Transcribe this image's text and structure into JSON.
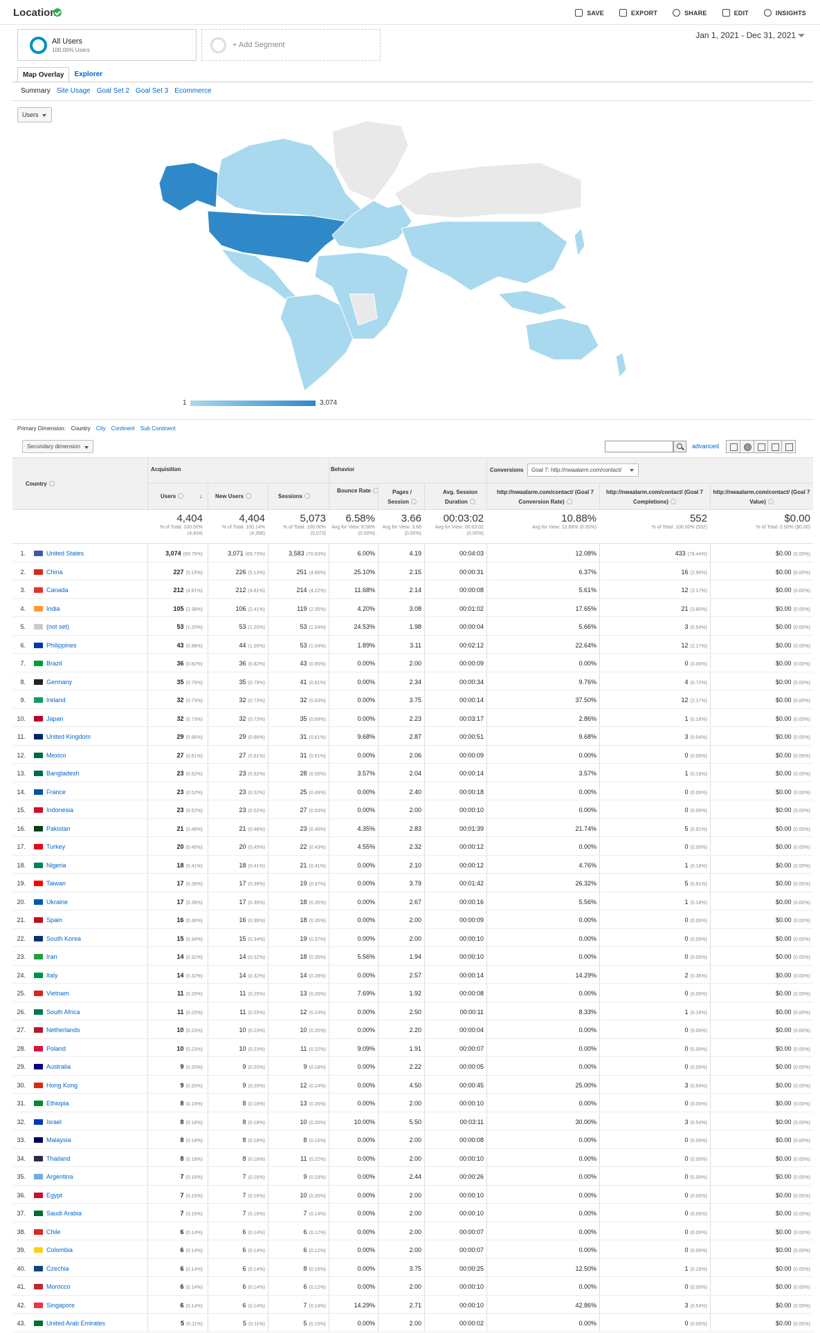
{
  "header": {
    "title": "Location",
    "actions": [
      {
        "label": "SAVE",
        "icon": "save-icon"
      },
      {
        "label": "EXPORT",
        "icon": "export-icon"
      },
      {
        "label": "SHARE",
        "icon": "share-icon"
      },
      {
        "label": "EDIT",
        "icon": "pencil-icon"
      },
      {
        "label": "INSIGHTS",
        "icon": "insights-icon"
      }
    ]
  },
  "segments": {
    "all_users": "All Users",
    "all_users_sub": "100.00% Users",
    "add_segment": "+ Add Segment"
  },
  "date_range": "Jan 1, 2021 - Dec 31, 2021",
  "view_tabs": [
    "Map Overlay",
    "Explorer"
  ],
  "sub_tabs": [
    "Summary",
    "Site Usage",
    "Goal Set 2",
    "Goal Set 3",
    "Ecommerce"
  ],
  "metric_select": "Users",
  "map": {
    "legend_min": "1",
    "legend_max": "3,074",
    "colors": {
      "low": "#a8d9ef",
      "high": "#2f88c7",
      "none": "#e9e9e9"
    }
  },
  "primary_dimension": {
    "label": "Primary Dimension:",
    "options": [
      "Country",
      "City",
      "Continent",
      "Sub Continent"
    ]
  },
  "secondary_dimension": "Secondary dimension",
  "advanced": "advanced",
  "table": {
    "groups": {
      "country": "Country",
      "acquisition": "Acquisition",
      "behavior": "Behavior",
      "conversions": "Conversions",
      "goal_select": "Goal 7: http://nwaalarm.com/contact/"
    },
    "columns": [
      "Users",
      "New Users",
      "Sessions",
      "Bounce Rate",
      "Pages / Session",
      "Avg. Session Duration",
      "http://nwaalarm.com/contact/ (Goal 7 Conversion Rate)",
      "http://nwaalarm.com/contact/ (Goal 7 Completions)",
      "http://nwaalarm.com/contact/ (Goal 7 Value)"
    ],
    "totals": [
      {
        "value": "4,404",
        "sub": "% of Total: 100.00% (4,404)"
      },
      {
        "value": "4,404",
        "sub": "% of Total: 100.14% (4,398)"
      },
      {
        "value": "5,073",
        "sub": "% of Total: 100.00% (5,073)"
      },
      {
        "value": "6.58%",
        "sub": "Avg for View: 6.58% (0.00%)"
      },
      {
        "value": "3.66",
        "sub": "Avg for View: 3.66 (0.00%)"
      },
      {
        "value": "00:03:02",
        "sub": "Avg for View: 00:03:02 (0.00%)"
      },
      {
        "value": "10.88%",
        "sub": "Avg for View: 10.88% (0.00%)"
      },
      {
        "value": "552",
        "sub": "% of Total: 100.00% (552)"
      },
      {
        "value": "$0.00",
        "sub": "% of Total: 0.00% ($0.00)"
      }
    ],
    "rows": [
      [
        "1.",
        "United States",
        "3,074",
        "(69.75%)",
        "3,071",
        "(69.73%)",
        "3,583",
        "(70.63%)",
        "6.00%",
        "4.19",
        "00:04:03",
        "12.08%",
        "433",
        "(78.44%)",
        "$0.00",
        "(0.00%)"
      ],
      [
        "2.",
        "China",
        "227",
        "(5.15%)",
        "226",
        "(5.13%)",
        "251",
        "(4.95%)",
        "25.10%",
        "2.15",
        "00:00:31",
        "6.37%",
        "16",
        "(2.90%)",
        "$0.00",
        "(0.00%)"
      ],
      [
        "3.",
        "Canada",
        "212",
        "(4.81%)",
        "212",
        "(4.81%)",
        "214",
        "(4.22%)",
        "11.68%",
        "2.14",
        "00:00:08",
        "5.61%",
        "12",
        "(2.17%)",
        "$0.00",
        "(0.00%)"
      ],
      [
        "4.",
        "India",
        "105",
        "(2.38%)",
        "106",
        "(2.41%)",
        "119",
        "(2.35%)",
        "4.20%",
        "3.08",
        "00:01:02",
        "17.65%",
        "21",
        "(3.80%)",
        "$0.00",
        "(0.00%)"
      ],
      [
        "5.",
        "(not set)",
        "53",
        "(1.20%)",
        "53",
        "(1.20%)",
        "53",
        "(1.04%)",
        "24.53%",
        "1.98",
        "00:00:04",
        "5.66%",
        "3",
        "(0.54%)",
        "$0.00",
        "(0.00%)"
      ],
      [
        "6.",
        "Philippines",
        "43",
        "(0.98%)",
        "44",
        "(1.00%)",
        "53",
        "(1.04%)",
        "1.89%",
        "3.11",
        "00:02:12",
        "22.64%",
        "12",
        "(2.17%)",
        "$0.00",
        "(0.00%)"
      ],
      [
        "7.",
        "Brazil",
        "36",
        "(0.82%)",
        "36",
        "(0.82%)",
        "43",
        "(0.85%)",
        "0.00%",
        "2.00",
        "00:00:09",
        "0.00%",
        "0",
        "(0.00%)",
        "$0.00",
        "(0.00%)"
      ],
      [
        "8.",
        "Germany",
        "35",
        "(0.79%)",
        "35",
        "(0.79%)",
        "41",
        "(0.81%)",
        "0.00%",
        "2.34",
        "00:00:34",
        "9.76%",
        "4",
        "(0.72%)",
        "$0.00",
        "(0.00%)"
      ],
      [
        "9.",
        "Ireland",
        "32",
        "(0.73%)",
        "32",
        "(0.73%)",
        "32",
        "(0.63%)",
        "0.00%",
        "3.75",
        "00:00:14",
        "37.50%",
        "12",
        "(2.17%)",
        "$0.00",
        "(0.00%)"
      ],
      [
        "10.",
        "Japan",
        "32",
        "(0.73%)",
        "32",
        "(0.73%)",
        "35",
        "(0.69%)",
        "0.00%",
        "2.23",
        "00:03:17",
        "2.86%",
        "1",
        "(0.18%)",
        "$0.00",
        "(0.00%)"
      ],
      [
        "11.",
        "United Kingdom",
        "29",
        "(0.66%)",
        "29",
        "(0.66%)",
        "31",
        "(0.61%)",
        "9.68%",
        "2.87",
        "00:00:51",
        "9.68%",
        "3",
        "(0.54%)",
        "$0.00",
        "(0.00%)"
      ],
      [
        "12.",
        "Mexico",
        "27",
        "(0.61%)",
        "27",
        "(0.61%)",
        "31",
        "(0.61%)",
        "0.00%",
        "2.06",
        "00:00:09",
        "0.00%",
        "0",
        "(0.00%)",
        "$0.00",
        "(0.00%)"
      ],
      [
        "13.",
        "Bangladesh",
        "23",
        "(0.52%)",
        "23",
        "(0.52%)",
        "28",
        "(0.55%)",
        "3.57%",
        "2.04",
        "00:00:14",
        "3.57%",
        "1",
        "(0.18%)",
        "$0.00",
        "(0.00%)"
      ],
      [
        "14.",
        "France",
        "23",
        "(0.52%)",
        "23",
        "(0.52%)",
        "25",
        "(0.49%)",
        "0.00%",
        "2.40",
        "00:00:18",
        "0.00%",
        "0",
        "(0.00%)",
        "$0.00",
        "(0.00%)"
      ],
      [
        "15.",
        "Indonesia",
        "23",
        "(0.52%)",
        "23",
        "(0.52%)",
        "27",
        "(0.53%)",
        "0.00%",
        "2.00",
        "00:00:10",
        "0.00%",
        "0",
        "(0.00%)",
        "$0.00",
        "(0.00%)"
      ],
      [
        "16.",
        "Pakistan",
        "21",
        "(0.48%)",
        "21",
        "(0.48%)",
        "23",
        "(0.45%)",
        "4.35%",
        "2.83",
        "00:01:39",
        "21.74%",
        "5",
        "(0.91%)",
        "$0.00",
        "(0.00%)"
      ],
      [
        "17.",
        "Turkey",
        "20",
        "(0.45%)",
        "20",
        "(0.45%)",
        "22",
        "(0.43%)",
        "4.55%",
        "2.32",
        "00:00:12",
        "0.00%",
        "0",
        "(0.00%)",
        "$0.00",
        "(0.00%)"
      ],
      [
        "18.",
        "Nigeria",
        "18",
        "(0.41%)",
        "18",
        "(0.41%)",
        "21",
        "(0.41%)",
        "0.00%",
        "2.10",
        "00:00:12",
        "4.76%",
        "1",
        "(0.18%)",
        "$0.00",
        "(0.00%)"
      ],
      [
        "19.",
        "Taiwan",
        "17",
        "(0.39%)",
        "17",
        "(0.39%)",
        "19",
        "(0.37%)",
        "0.00%",
        "3.79",
        "00:01:42",
        "26.32%",
        "5",
        "(0.91%)",
        "$0.00",
        "(0.00%)"
      ],
      [
        "20.",
        "Ukraine",
        "17",
        "(0.39%)",
        "17",
        "(0.39%)",
        "18",
        "(0.35%)",
        "0.00%",
        "2.67",
        "00:00:16",
        "5.56%",
        "1",
        "(0.18%)",
        "$0.00",
        "(0.00%)"
      ],
      [
        "21.",
        "Spain",
        "16",
        "(0.36%)",
        "16",
        "(0.36%)",
        "18",
        "(0.35%)",
        "0.00%",
        "2.00",
        "00:00:09",
        "0.00%",
        "0",
        "(0.00%)",
        "$0.00",
        "(0.00%)"
      ],
      [
        "22.",
        "South Korea",
        "15",
        "(0.34%)",
        "15",
        "(0.34%)",
        "19",
        "(0.37%)",
        "0.00%",
        "2.00",
        "00:00:10",
        "0.00%",
        "0",
        "(0.00%)",
        "$0.00",
        "(0.00%)"
      ],
      [
        "23.",
        "Iran",
        "14",
        "(0.32%)",
        "14",
        "(0.32%)",
        "18",
        "(0.35%)",
        "5.56%",
        "1.94",
        "00:00:10",
        "0.00%",
        "0",
        "(0.00%)",
        "$0.00",
        "(0.00%)"
      ],
      [
        "24.",
        "Italy",
        "14",
        "(0.32%)",
        "14",
        "(0.32%)",
        "14",
        "(0.28%)",
        "0.00%",
        "2.57",
        "00:00:14",
        "14.29%",
        "2",
        "(0.36%)",
        "$0.00",
        "(0.00%)"
      ],
      [
        "25.",
        "Vietnam",
        "11",
        "(0.25%)",
        "11",
        "(0.25%)",
        "13",
        "(0.26%)",
        "7.69%",
        "1.92",
        "00:00:08",
        "0.00%",
        "0",
        "(0.00%)",
        "$0.00",
        "(0.00%)"
      ],
      [
        "26.",
        "South Africa",
        "11",
        "(0.25%)",
        "11",
        "(0.25%)",
        "12",
        "(0.24%)",
        "0.00%",
        "2.50",
        "00:00:11",
        "8.33%",
        "1",
        "(0.18%)",
        "$0.00",
        "(0.00%)"
      ],
      [
        "27.",
        "Netherlands",
        "10",
        "(0.23%)",
        "10",
        "(0.23%)",
        "10",
        "(0.20%)",
        "0.00%",
        "2.20",
        "00:00:04",
        "0.00%",
        "0",
        "(0.00%)",
        "$0.00",
        "(0.00%)"
      ],
      [
        "28.",
        "Poland",
        "10",
        "(0.23%)",
        "10",
        "(0.23%)",
        "11",
        "(0.22%)",
        "9.09%",
        "1.91",
        "00:00:07",
        "0.00%",
        "0",
        "(0.00%)",
        "$0.00",
        "(0.00%)"
      ],
      [
        "29.",
        "Australia",
        "9",
        "(0.20%)",
        "9",
        "(0.20%)",
        "9",
        "(0.18%)",
        "0.00%",
        "2.22",
        "00:00:05",
        "0.00%",
        "0",
        "(0.00%)",
        "$0.00",
        "(0.00%)"
      ],
      [
        "30.",
        "Hong Kong",
        "9",
        "(0.20%)",
        "9",
        "(0.20%)",
        "12",
        "(0.24%)",
        "0.00%",
        "4.50",
        "00:00:45",
        "25.00%",
        "3",
        "(0.54%)",
        "$0.00",
        "(0.00%)"
      ],
      [
        "31.",
        "Ethiopia",
        "8",
        "(0.18%)",
        "8",
        "(0.18%)",
        "13",
        "(0.26%)",
        "0.00%",
        "2.00",
        "00:00:10",
        "0.00%",
        "0",
        "(0.00%)",
        "$0.00",
        "(0.00%)"
      ],
      [
        "32.",
        "Israel",
        "8",
        "(0.18%)",
        "8",
        "(0.18%)",
        "10",
        "(0.20%)",
        "10.00%",
        "5.50",
        "00:03:11",
        "30.00%",
        "3",
        "(0.54%)",
        "$0.00",
        "(0.00%)"
      ],
      [
        "33.",
        "Malaysia",
        "8",
        "(0.18%)",
        "8",
        "(0.18%)",
        "8",
        "(0.16%)",
        "0.00%",
        "2.00",
        "00:00:08",
        "0.00%",
        "0",
        "(0.00%)",
        "$0.00",
        "(0.00%)"
      ],
      [
        "34.",
        "Thailand",
        "8",
        "(0.18%)",
        "8",
        "(0.18%)",
        "11",
        "(0.22%)",
        "0.00%",
        "2.00",
        "00:00:10",
        "0.00%",
        "0",
        "(0.00%)",
        "$0.00",
        "(0.00%)"
      ],
      [
        "35.",
        "Argentina",
        "7",
        "(0.16%)",
        "7",
        "(0.16%)",
        "9",
        "(0.18%)",
        "0.00%",
        "2.44",
        "00:00:26",
        "0.00%",
        "0",
        "(0.00%)",
        "$0.00",
        "(0.00%)"
      ],
      [
        "36.",
        "Egypt",
        "7",
        "(0.16%)",
        "7",
        "(0.16%)",
        "10",
        "(0.20%)",
        "0.00%",
        "2.00",
        "00:00:10",
        "0.00%",
        "0",
        "(0.00%)",
        "$0.00",
        "(0.00%)"
      ],
      [
        "37.",
        "Saudi Arabia",
        "7",
        "(0.16%)",
        "7",
        "(0.16%)",
        "7",
        "(0.14%)",
        "0.00%",
        "2.00",
        "00:00:10",
        "0.00%",
        "0",
        "(0.00%)",
        "$0.00",
        "(0.00%)"
      ],
      [
        "38.",
        "Chile",
        "6",
        "(0.14%)",
        "6",
        "(0.14%)",
        "6",
        "(0.12%)",
        "0.00%",
        "2.00",
        "00:00:07",
        "0.00%",
        "0",
        "(0.00%)",
        "$0.00",
        "(0.00%)"
      ],
      [
        "39.",
        "Colombia",
        "6",
        "(0.14%)",
        "6",
        "(0.14%)",
        "6",
        "(0.12%)",
        "0.00%",
        "2.00",
        "00:00:07",
        "0.00%",
        "0",
        "(0.00%)",
        "$0.00",
        "(0.00%)"
      ],
      [
        "40.",
        "Czechia",
        "6",
        "(0.14%)",
        "6",
        "(0.14%)",
        "8",
        "(0.16%)",
        "0.00%",
        "3.75",
        "00:00:25",
        "12.50%",
        "1",
        "(0.18%)",
        "$0.00",
        "(0.00%)"
      ],
      [
        "41.",
        "Morocco",
        "6",
        "(0.14%)",
        "6",
        "(0.14%)",
        "6",
        "(0.12%)",
        "0.00%",
        "2.00",
        "00:00:10",
        "0.00%",
        "0",
        "(0.00%)",
        "$0.00",
        "(0.00%)"
      ],
      [
        "42.",
        "Singapore",
        "6",
        "(0.14%)",
        "6",
        "(0.14%)",
        "7",
        "(0.14%)",
        "14.29%",
        "2.71",
        "00:00:10",
        "42.86%",
        "3",
        "(0.54%)",
        "$0.00",
        "(0.00%)"
      ],
      [
        "43.",
        "United Arab Emirates",
        "5",
        "(0.11%)",
        "5",
        "(0.11%)",
        "5",
        "(0.10%)",
        "0.00%",
        "2.00",
        "00:00:02",
        "0.00%",
        "0",
        "(0.00%)",
        "$0.00",
        "(0.00%)"
      ]
    ]
  }
}
